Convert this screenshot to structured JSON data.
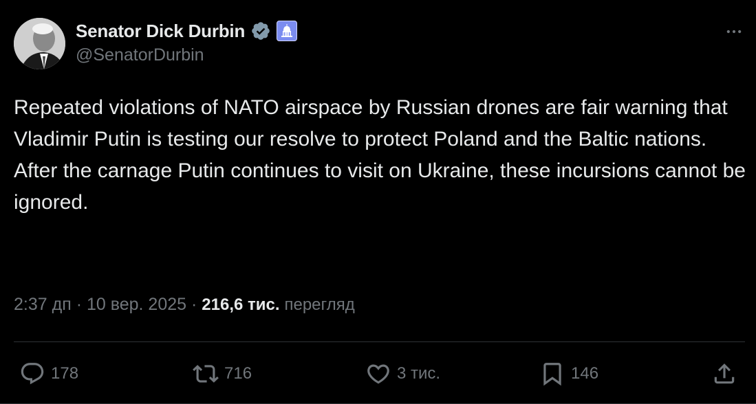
{
  "author": {
    "display_name": "Senator Dick Durbin",
    "handle": "@SenatorDurbin",
    "verified_icon": "verified-badge-icon",
    "affiliation_icon": "capitol-building-icon"
  },
  "tweet": {
    "text": "Repeated violations of NATO airspace by Russian drones are fair warning that Vladimir Putin is testing our resolve to protect Poland and the Baltic nations. After the carnage Putin continues to visit on Ukraine, these incursions cannot be ignored."
  },
  "meta": {
    "time": "2:37 дп",
    "separator": "·",
    "date": "10 вер. 2025",
    "views_count": "216,6 тис.",
    "views_label": "перегляд"
  },
  "actions": {
    "replies": "178",
    "reposts": "716",
    "likes": "3 тис.",
    "bookmarks": "146"
  },
  "colors": {
    "background": "#000000",
    "primary_text": "#e7e9ea",
    "secondary_text": "#71767b",
    "verified_badge": "#829aab",
    "divider": "#2f3336"
  }
}
